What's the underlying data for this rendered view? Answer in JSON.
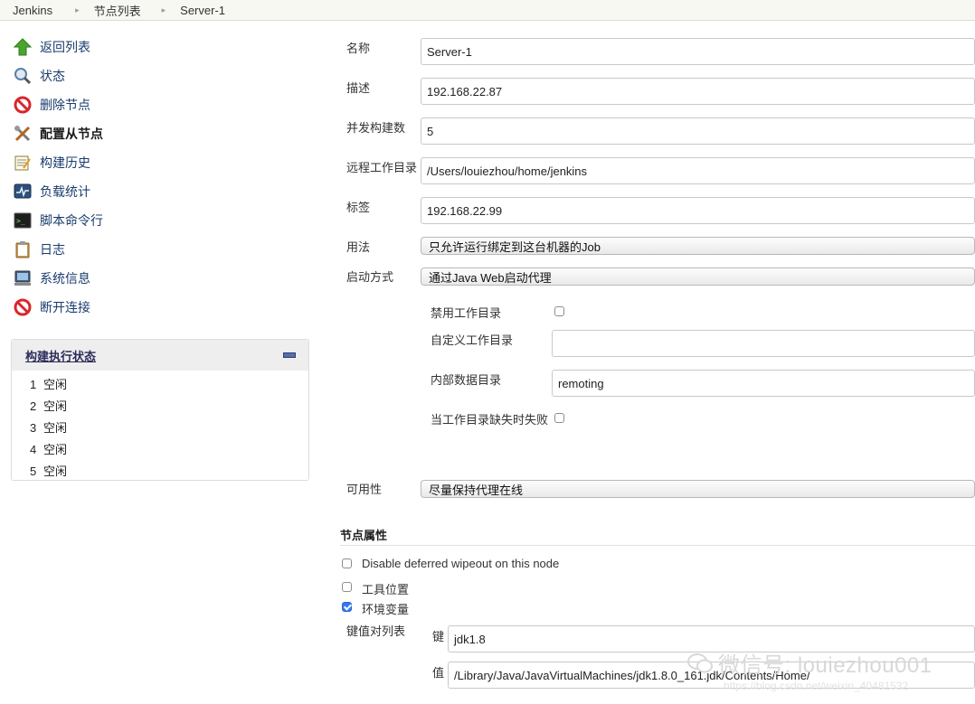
{
  "breadcrumb": [
    "Jenkins",
    "节点列表",
    "Server-1"
  ],
  "sidebar": {
    "items": [
      {
        "label": "返回列表",
        "icon": "up-arrow-icon"
      },
      {
        "label": "状态",
        "icon": "search-icon"
      },
      {
        "label": "删除节点",
        "icon": "no-entry-icon"
      },
      {
        "label": "配置从节点",
        "icon": "tools-icon"
      },
      {
        "label": "构建历史",
        "icon": "notepad-icon"
      },
      {
        "label": "负载统计",
        "icon": "monitor-graph-icon"
      },
      {
        "label": "脚本命令行",
        "icon": "terminal-icon"
      },
      {
        "label": "日志",
        "icon": "clipboard-icon"
      },
      {
        "label": "系统信息",
        "icon": "computer-icon"
      },
      {
        "label": "断开连接",
        "icon": "no-entry-icon"
      }
    ]
  },
  "executors": {
    "title": "构建执行状态",
    "rows": [
      {
        "num": "1",
        "status": "空闲"
      },
      {
        "num": "2",
        "status": "空闲"
      },
      {
        "num": "3",
        "status": "空闲"
      },
      {
        "num": "4",
        "status": "空闲"
      },
      {
        "num": "5",
        "status": "空闲"
      }
    ]
  },
  "form": {
    "name_label": "名称",
    "name_value": "Server-1",
    "desc_label": "描述",
    "desc_value": "192.168.22.87",
    "executors_label": "并发构建数",
    "executors_value": "5",
    "remote_dir_label": "远程工作目录",
    "remote_dir_value": "/Users/louiezhou/home/jenkins",
    "labels_label": "标签",
    "labels_value": "192.168.22.99",
    "usage_label": "用法",
    "usage_value": "只允许运行绑定到这台机器的Job",
    "launch_label": "启动方式",
    "launch_value": "通过Java Web启动代理",
    "disable_workdir_label": "禁用工作目录",
    "custom_workdir_label": "自定义工作目录",
    "custom_workdir_value": "",
    "internal_dir_label": "内部数据目录",
    "internal_dir_value": "remoting",
    "fail_missing_label": "当工作目录缺失时失败",
    "availability_label": "可用性",
    "availability_value": "尽量保持代理在线"
  },
  "node_properties": {
    "title": "节点属性",
    "disable_wipeout_label": "Disable deferred wipeout on this node",
    "tool_locations_label": "工具位置",
    "env_vars_label": "环境变量",
    "kv_list_label": "键值对列表",
    "key_label": "键",
    "key_value": "jdk1.8",
    "value_label": "值",
    "value_value": "/Library/Java/JavaVirtualMachines/jdk1.8.0_161.jdk/Contents/Home/"
  },
  "watermark": {
    "text": "微信号: louiezhou001",
    "url": "https://blog.csdn.net/weixin_40481532"
  }
}
